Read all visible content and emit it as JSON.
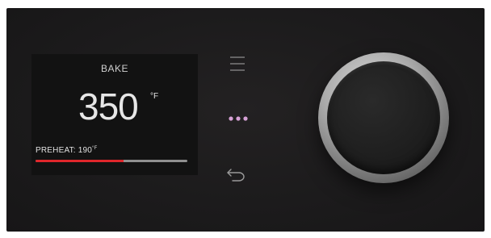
{
  "display": {
    "mode": "BAKE",
    "temperature": "350",
    "temperature_unit": "°F",
    "preheat_label": "PREHEAT: 190",
    "preheat_unit": "°F",
    "preheat_progress_fraction": 0.58
  },
  "controls": {
    "menu_icon": "menu-icon",
    "more_icon": "more-icon",
    "back_icon": "back-icon",
    "knob": "control-knob"
  },
  "colors": {
    "accent_red": "#e0262b",
    "more_dots": "#d6a1d6",
    "icon_gray": "#9a9a9a"
  }
}
